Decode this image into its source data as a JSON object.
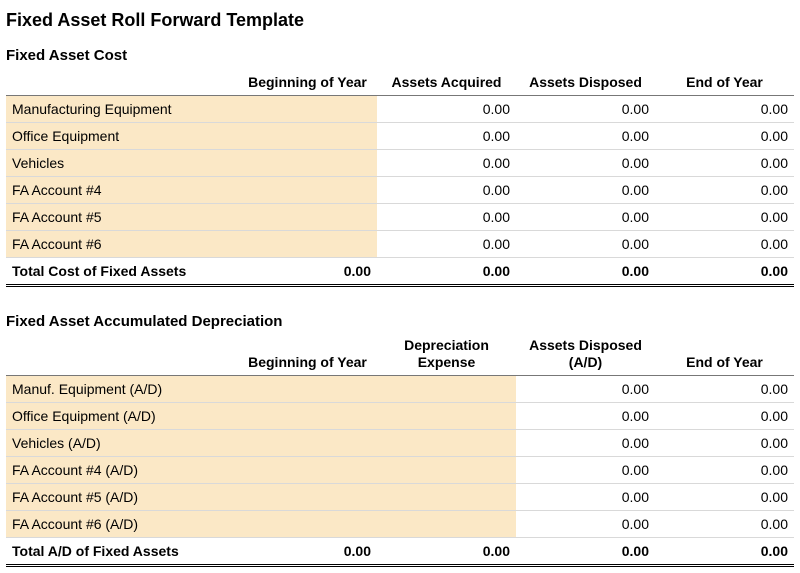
{
  "title": "Fixed Asset Roll Forward Template",
  "cost": {
    "heading": "Fixed Asset Cost",
    "headers": {
      "label": "",
      "beg": "Beginning of Year",
      "acq": "Assets Acquired",
      "disp": "Assets Disposed",
      "end": "End of Year"
    },
    "rows": [
      {
        "label": "Manufacturing Equipment",
        "beg": "",
        "acq": "0.00",
        "disp": "0.00",
        "end": "0.00"
      },
      {
        "label": "Office Equipment",
        "beg": "",
        "acq": "0.00",
        "disp": "0.00",
        "end": "0.00"
      },
      {
        "label": "Vehicles",
        "beg": "",
        "acq": "0.00",
        "disp": "0.00",
        "end": "0.00"
      },
      {
        "label": "FA Account #4",
        "beg": "",
        "acq": "0.00",
        "disp": "0.00",
        "end": "0.00"
      },
      {
        "label": "FA Account #5",
        "beg": "",
        "acq": "0.00",
        "disp": "0.00",
        "end": "0.00"
      },
      {
        "label": "FA Account #6",
        "beg": "",
        "acq": "0.00",
        "disp": "0.00",
        "end": "0.00"
      }
    ],
    "total": {
      "label": "Total Cost of Fixed Assets",
      "beg": "0.00",
      "acq": "0.00",
      "disp": "0.00",
      "end": "0.00"
    }
  },
  "ad": {
    "heading": "Fixed Asset Accumulated Depreciation",
    "headers": {
      "label": "",
      "beg": "Beginning of Year",
      "dep": "Depreciation Expense",
      "disp": "Assets Disposed (A/D)",
      "end": "End of Year"
    },
    "rows": [
      {
        "label": "Manuf. Equipment (A/D)",
        "beg": "",
        "dep": "",
        "disp": "0.00",
        "end": "0.00"
      },
      {
        "label": "Office Equipment (A/D)",
        "beg": "",
        "dep": "",
        "disp": "0.00",
        "end": "0.00"
      },
      {
        "label": "Vehicles (A/D)",
        "beg": "",
        "dep": "",
        "disp": "0.00",
        "end": "0.00"
      },
      {
        "label": "FA Account #4 (A/D)",
        "beg": "",
        "dep": "",
        "disp": "0.00",
        "end": "0.00"
      },
      {
        "label": "FA Account #5 (A/D)",
        "beg": "",
        "dep": "",
        "disp": "0.00",
        "end": "0.00"
      },
      {
        "label": "FA Account #6 (A/D)",
        "beg": "",
        "dep": "",
        "disp": "0.00",
        "end": "0.00"
      }
    ],
    "total": {
      "label": "Total A/D of Fixed Assets",
      "beg": "0.00",
      "dep": "0.00",
      "disp": "0.00",
      "end": "0.00"
    }
  }
}
